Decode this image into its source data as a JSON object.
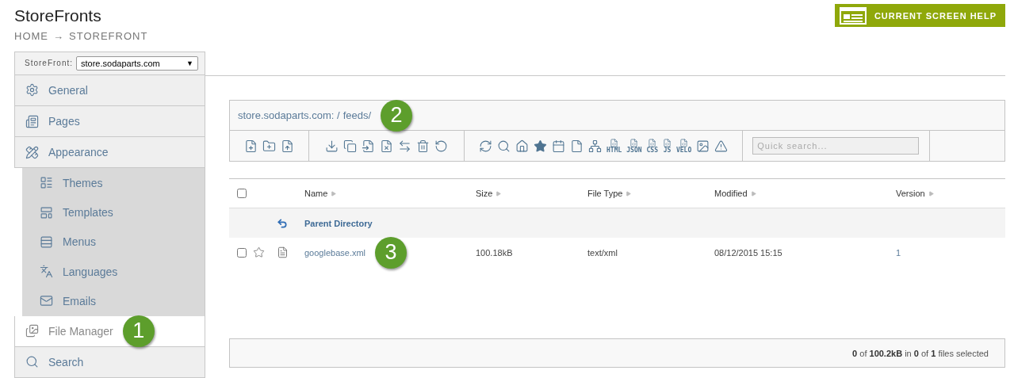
{
  "page": {
    "title": "StoreFronts",
    "breadcrumb": [
      "HOME",
      "→",
      "STOREFRONT"
    ]
  },
  "help_button": {
    "label": "CURRENT SCREEN HELP"
  },
  "sidebar": {
    "selector": {
      "label": "StoreFront:",
      "value": "store.sodaparts.com",
      "arrow": "▼"
    },
    "items": [
      {
        "label": "General",
        "selected": false
      },
      {
        "label": "Pages",
        "selected": false
      },
      {
        "label": "Appearance",
        "selected": false,
        "expanded": true,
        "children": [
          {
            "label": "Themes",
            "selected": false
          },
          {
            "label": "Templates",
            "selected": false
          },
          {
            "label": "Menus",
            "selected": false
          },
          {
            "label": "Languages",
            "selected": false
          },
          {
            "label": "Emails",
            "selected": false
          }
        ]
      },
      {
        "label": "File Manager",
        "selected": true,
        "callout": "1"
      },
      {
        "label": "Search",
        "selected": false
      }
    ]
  },
  "path_bar": {
    "root": "store.sodaparts.com: /",
    "folder": "feeds/",
    "callout": "2"
  },
  "toolbar": {
    "template_labels": [
      "HTML",
      "JSON",
      "CSS",
      "JS",
      "VELO"
    ],
    "search": {
      "placeholder": "Quick search..."
    }
  },
  "table": {
    "select_all": {
      "checked": false
    },
    "columns": [
      "Name",
      "Size",
      "File Type",
      "Modified",
      "Version"
    ],
    "rows": [
      {
        "kind": "parent",
        "name": "Parent Directory"
      },
      {
        "kind": "file",
        "checked": false,
        "starred": false,
        "name": "googlebase.xml",
        "size": "100.18kB",
        "file_type": "text/xml",
        "modified": "08/12/2015 15:15",
        "version": "1",
        "callout": "3"
      }
    ]
  },
  "status_bar": {
    "summary": "**0** of **100.2kB** in **0** of **1** files selected"
  }
}
